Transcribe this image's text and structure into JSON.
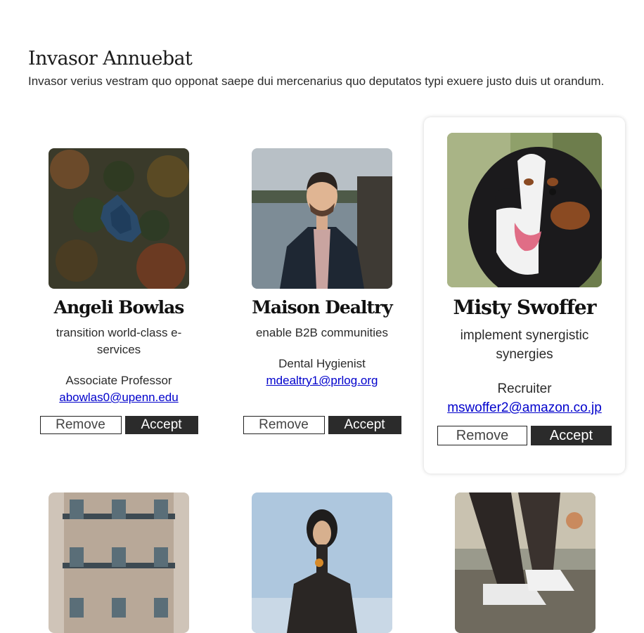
{
  "header": {
    "title": "Invasor Annuebat",
    "description": "Invasor verius vestram quo opponat saepe dui mercenarius quo deputatos typi exuere justo duis ut orandum."
  },
  "cards": [
    {
      "name": "Angeli Bowlas",
      "tagline": "transition world-class e-services",
      "role": "Associate Professor",
      "email": "abowlas0@upenn.edu",
      "remove_label": "Remove",
      "accept_label": "Accept"
    },
    {
      "name": "Maison Dealtry",
      "tagline": "enable B2B communities",
      "role": "Dental Hygienist",
      "email": "mdealtry1@prlog.org",
      "remove_label": "Remove",
      "accept_label": "Accept"
    },
    {
      "name": "Misty Swoffer",
      "tagline": "implement synergistic synergies",
      "role": "Recruiter",
      "email": "mswoffer2@amazon.co.jp",
      "remove_label": "Remove",
      "accept_label": "Accept"
    }
  ],
  "colors": {
    "link": "#0000cc",
    "accept_bg": "#2b2b2b",
    "card_bg": "#ffffff"
  }
}
